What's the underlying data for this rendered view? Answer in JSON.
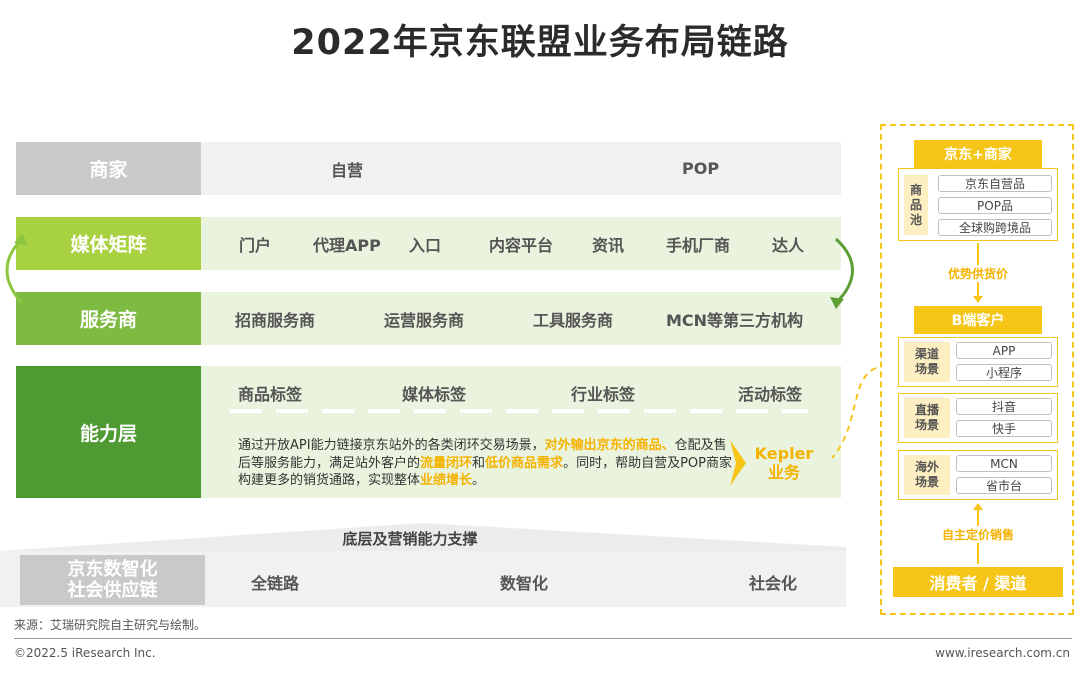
{
  "title": "2022年京东联盟业务布局链路",
  "rows": {
    "merchant": {
      "label": "商家",
      "items": [
        "自营",
        "POP"
      ]
    },
    "media": {
      "label": "媒体矩阵",
      "items": [
        "门户",
        "代理APP",
        "入口",
        "内容平台",
        "资讯",
        "手机厂商",
        "达人"
      ]
    },
    "service": {
      "label": "服务商",
      "items": [
        "招商服务商",
        "运营服务商",
        "工具服务商",
        "MCN等第三方机构"
      ]
    },
    "ability": {
      "label": "能力层",
      "tags": [
        "商品标签",
        "媒体标签",
        "行业标签",
        "活动标签"
      ],
      "para": {
        "p1": "通过开放API能力链接京东站外的各类闭环交易场景，",
        "h1": "对外输出京东的商品、",
        "p2": "仓配及售后等服务能力，满足站外客户的",
        "h2": "流量闭环",
        "p3": "和",
        "h3": "低价商品需求",
        "p4": "。同时，帮助自营及POP商家构建更多的销货通路，实现整体",
        "h4": "业绩增长",
        "p5": "。"
      },
      "kepler_line1": "Kepler",
      "kepler_line2": "业务"
    }
  },
  "base": {
    "title": "底层及营销能力支撑",
    "label_line1": "京东数智化",
    "label_line2": "社会供应链",
    "items": [
      "全链路",
      "数智化",
      "社会化"
    ]
  },
  "panel": {
    "top_header": "京东+商家",
    "pool_label": "商品池",
    "pool_items": [
      "京东自营品",
      "POP品",
      "全球购跨境品"
    ],
    "note_advantage": "优势供货价",
    "b_header": "B端客户",
    "groups": [
      {
        "label": "渠道场景",
        "items": [
          "APP",
          "小程序"
        ]
      },
      {
        "label": "直播场景",
        "items": [
          "抖音",
          "快手"
        ]
      },
      {
        "label": "海外场景",
        "items": [
          "MCN",
          "省市台"
        ]
      }
    ],
    "note_pricing": "自主定价销售",
    "bottom_header": "消费者 / 渠道"
  },
  "footer": {
    "source": "来源：艾瑞研究院自主研究与绘制。",
    "copyright": "©2022.5 iResearch Inc.",
    "url": "www.iresearch.com.cn"
  },
  "colors": {
    "gray": "#c9c9c9",
    "gray_light": "#f1f1f1",
    "green1": "#a9d243",
    "green2": "#7dbb42",
    "green3": "#4f9a33",
    "green_light": "#eaf3dd",
    "yellow": "#f5c518",
    "highlight": "#f5b301"
  }
}
